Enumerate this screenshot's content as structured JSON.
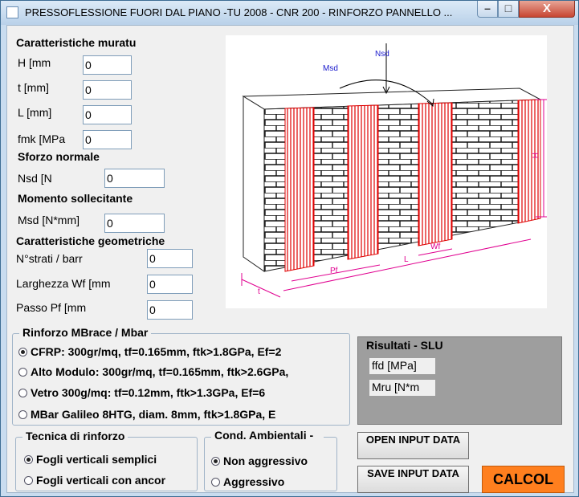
{
  "window": {
    "title": "PRESSOFLESSIONE FUORI DAL PIANO -TU 2008 - CNR 200 - RINFORZO PANNELLO ...",
    "minimize": "–",
    "maximize": "□",
    "close": "X"
  },
  "muratura": {
    "header": "Caratteristiche muratu",
    "H_label": "H [mm",
    "H_value": "0",
    "t_label": "t [mm]",
    "t_value": "0",
    "L_label": "L [mm]",
    "L_value": "0",
    "fmk_label": "fmk [MPa",
    "fmk_value": "0"
  },
  "sforzo": {
    "header": "Sforzo normale sollecitante",
    "nsd_label": "Nsd [N",
    "nsd_value": "0"
  },
  "momento": {
    "header": "Momento sollecitante",
    "msd_label": "Msd [N*mm]",
    "msd_value": "0"
  },
  "geometria": {
    "header": "Caratteristiche geometriche",
    "strati_label": "N°strati  / barr",
    "strati_value": "0",
    "wf_label": "Larghezza  Wf [mm",
    "wf_value": "0",
    "pf_label": "Passo  Pf [mm",
    "pf_value": "0"
  },
  "diagram": {
    "msd": "Msd",
    "nsd": "Nsd",
    "h": "H",
    "wf": "Wf",
    "pf": "Pf",
    "l": "L",
    "t": "t"
  },
  "rinforzo": {
    "title": "Rinforzo MBrace / Mbar",
    "options": [
      "CFRP:  300gr/mq,  tf=0.165mm,  ftk>1.8GPa, Ef=2",
      "Alto Modulo: 300gr/mq, tf=0.165mm, ftk>2.6GPa,",
      "Vetro  300g/mq:  tf=0.12mm,  ftk>1.3GPa, Ef=6",
      "MBar  Galileo  8HTG,  diam.  8mm,  ftk>1.8GPa, E"
    ],
    "selected": 0
  },
  "risultati": {
    "title": "Risultati - SLU",
    "ffd": "ffd [MPa]",
    "mru": "Mru [N*m"
  },
  "tecnica": {
    "title": "Tecnica di rinforzo",
    "options": [
      "Fogli verticali semplici",
      "Fogli  verticali  con ancor"
    ],
    "selected": 0
  },
  "ambiente": {
    "title": "Cond. Ambientali - Ce",
    "options": [
      "Non aggressivo",
      "Aggressivo"
    ],
    "selected": 0
  },
  "buttons": {
    "open": "OPEN INPUT DATA",
    "save": "SAVE INPUT DATA",
    "calcol": "CALCOL"
  }
}
